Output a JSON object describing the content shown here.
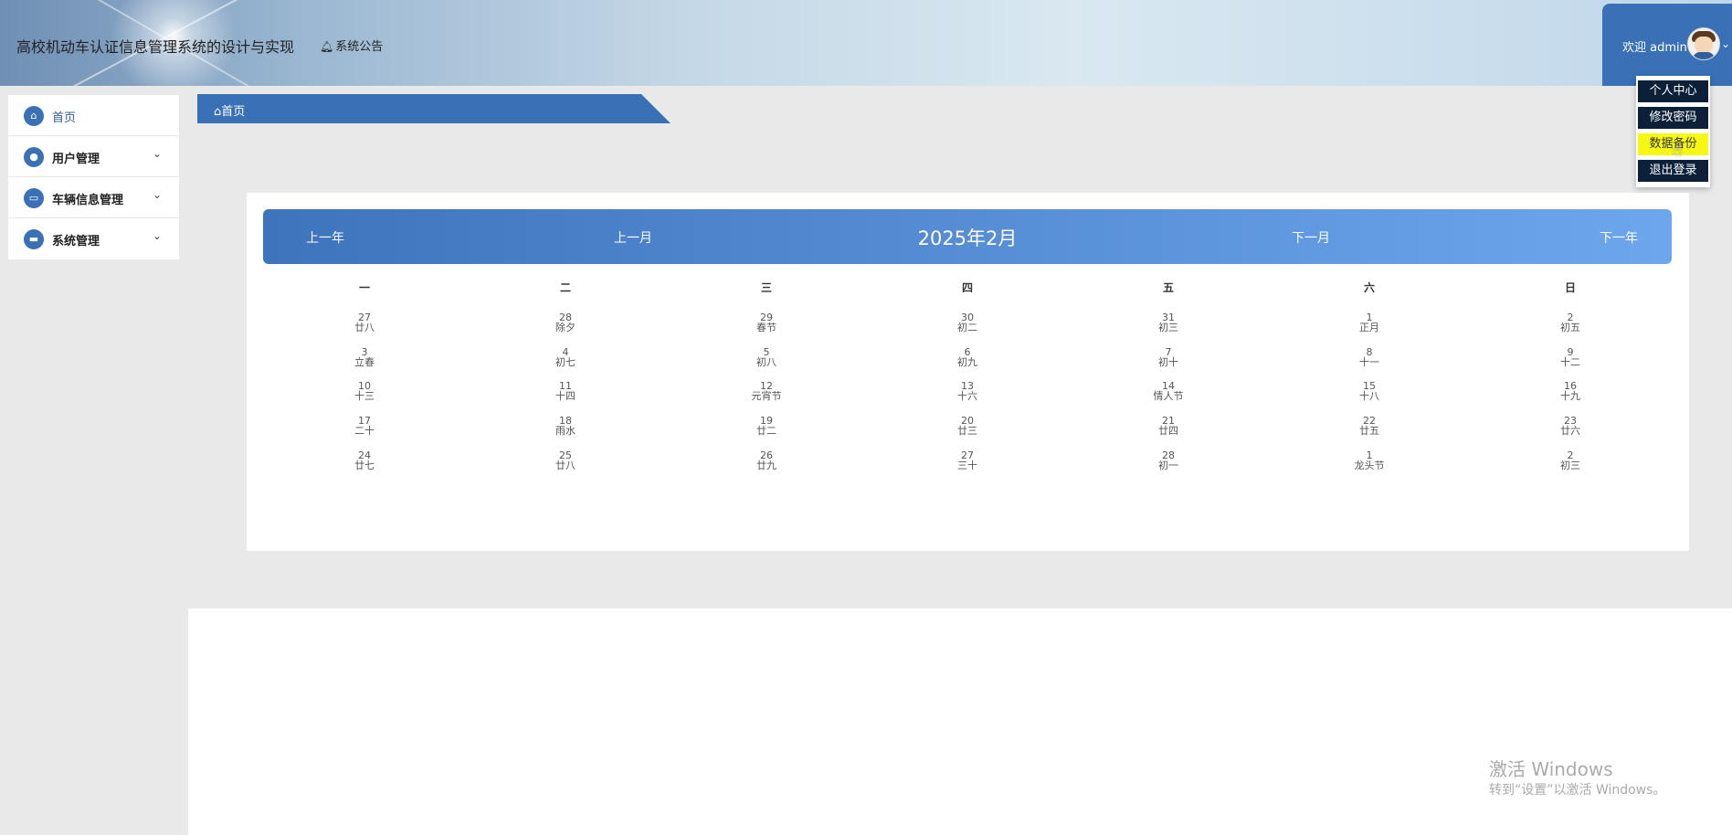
{
  "header": {
    "app_title": "高校机动车认证信息管理系统的设计与实现",
    "notice_label": "系统公告",
    "welcome_text": "欢迎 admin"
  },
  "user_menu": {
    "items": [
      {
        "label": "个人中心"
      },
      {
        "label": "修改密码"
      },
      {
        "label": "数据备份"
      },
      {
        "label": "退出登录"
      }
    ]
  },
  "sidebar": {
    "items": [
      {
        "label": "首页"
      },
      {
        "label": "用户管理"
      },
      {
        "label": "车辆信息管理"
      },
      {
        "label": "系统管理"
      }
    ]
  },
  "breadcrumb": {
    "label": "首页"
  },
  "calendar": {
    "prev_year": "上一年",
    "prev_month": "上一月",
    "title": "2025年2月",
    "next_month": "下一月",
    "next_year": "下一年",
    "weekdays": [
      "一",
      "二",
      "三",
      "四",
      "五",
      "六",
      "日"
    ],
    "weeks": [
      [
        [
          "27",
          "廿八"
        ],
        [
          "28",
          "除夕"
        ],
        [
          "29",
          "春节"
        ],
        [
          "30",
          "初二"
        ],
        [
          "31",
          "初三"
        ],
        [
          "1",
          "正月"
        ],
        [
          "2",
          "初五"
        ]
      ],
      [
        [
          "3",
          "立春"
        ],
        [
          "4",
          "初七"
        ],
        [
          "5",
          "初八"
        ],
        [
          "6",
          "初九"
        ],
        [
          "7",
          "初十"
        ],
        [
          "8",
          "十一"
        ],
        [
          "9",
          "十二"
        ]
      ],
      [
        [
          "10",
          "十三"
        ],
        [
          "11",
          "十四"
        ],
        [
          "12",
          "元宵节"
        ],
        [
          "13",
          "十六"
        ],
        [
          "14",
          "情人节"
        ],
        [
          "15",
          "十八"
        ],
        [
          "16",
          "十九"
        ]
      ],
      [
        [
          "17",
          "二十"
        ],
        [
          "18",
          "雨水"
        ],
        [
          "19",
          "廿二"
        ],
        [
          "20",
          "廿三"
        ],
        [
          "21",
          "廿四"
        ],
        [
          "22",
          "廿五"
        ],
        [
          "23",
          "廿六"
        ]
      ],
      [
        [
          "24",
          "廿七"
        ],
        [
          "25",
          "廿八"
        ],
        [
          "26",
          "廿九"
        ],
        [
          "27",
          "三十"
        ],
        [
          "28",
          "初一"
        ],
        [
          "1",
          "龙头节"
        ],
        [
          "2",
          "初三"
        ]
      ]
    ]
  },
  "watermark": {
    "line1": "激活 Windows",
    "line2": "转到“设置”以激活 Windows。"
  },
  "colors": {
    "primary": "#3a70b6",
    "menu_bg": "#0c2039",
    "menu_highlight": "#f7f714"
  }
}
